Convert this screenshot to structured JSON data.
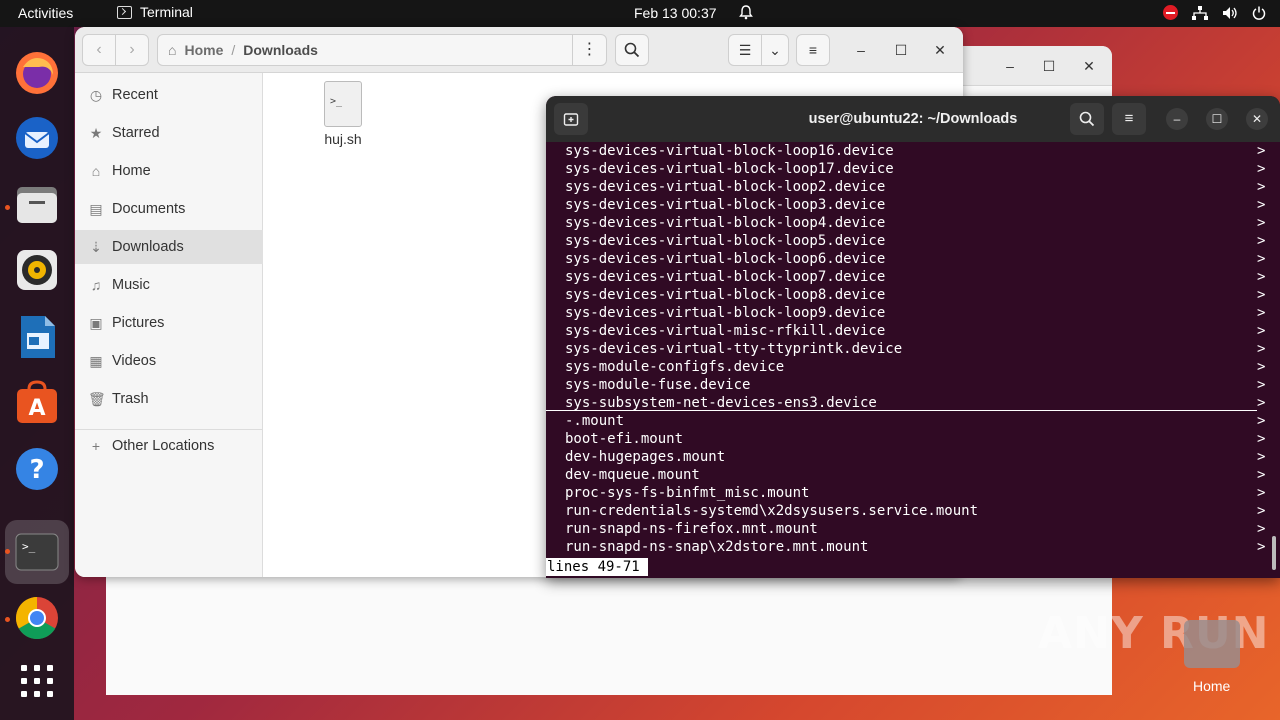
{
  "topbar": {
    "activities": "Activities",
    "app_name": "Terminal",
    "clock": "Feb 13  00:37"
  },
  "dock": {
    "items": [
      "firefox-icon",
      "thunderbird-icon",
      "files-icon",
      "rhythmbox-icon",
      "libreoffice-writer-icon",
      "ubuntu-software-icon",
      "help-icon",
      "terminal-icon",
      "chrome-icon",
      "show-apps-icon"
    ]
  },
  "files": {
    "path": {
      "home": "Home",
      "separator": "/",
      "current": "Downloads"
    },
    "sidebar": {
      "items": [
        {
          "label": "Recent",
          "icon": "clock-icon"
        },
        {
          "label": "Starred",
          "icon": "star-icon"
        },
        {
          "label": "Home",
          "icon": "home-icon"
        },
        {
          "label": "Documents",
          "icon": "document-icon"
        },
        {
          "label": "Downloads",
          "icon": "download-icon"
        },
        {
          "label": "Music",
          "icon": "music-icon"
        },
        {
          "label": "Pictures",
          "icon": "pictures-icon"
        },
        {
          "label": "Videos",
          "icon": "videos-icon"
        },
        {
          "label": "Trash",
          "icon": "trash-icon"
        }
      ],
      "other_locations": "Other Locations"
    },
    "file": {
      "name": "huj.sh",
      "icon_text": ">_"
    }
  },
  "terminal": {
    "title": "user@ubuntu22: ~/Downloads",
    "lines_top": [
      "sys-devices-virtual-block-loop16.device",
      "sys-devices-virtual-block-loop17.device",
      "sys-devices-virtual-block-loop2.device",
      "sys-devices-virtual-block-loop3.device",
      "sys-devices-virtual-block-loop4.device",
      "sys-devices-virtual-block-loop5.device",
      "sys-devices-virtual-block-loop6.device",
      "sys-devices-virtual-block-loop7.device",
      "sys-devices-virtual-block-loop8.device",
      "sys-devices-virtual-block-loop9.device",
      "sys-devices-virtual-misc-rfkill.device",
      "sys-devices-virtual-tty-ttyprintk.device",
      "sys-module-configfs.device",
      "sys-module-fuse.device",
      "sys-subsystem-net-devices-ens3.device"
    ],
    "lines_bottom": [
      "-.mount",
      "boot-efi.mount",
      "dev-hugepages.mount",
      "dev-mqueue.mount",
      "proc-sys-fs-binfmt_misc.mount",
      "run-credentials-systemd\\x2dsysusers.service.mount",
      "run-snapd-ns-firefox.mnt.mount",
      "run-snapd-ns-snap\\x2dstore.mnt.mount"
    ],
    "truncation_marker": ">",
    "status": "lines 49-71"
  },
  "desktop": {
    "home_label": "Home",
    "watermark": "ANY RUN"
  }
}
